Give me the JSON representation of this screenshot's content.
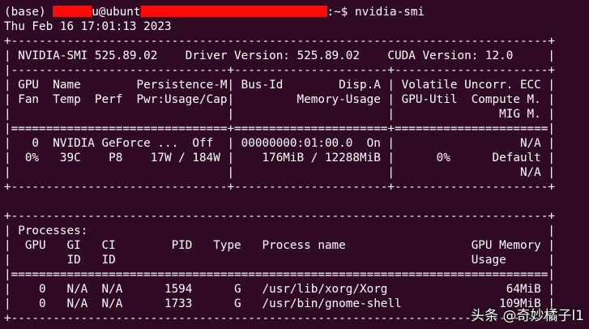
{
  "prompt": {
    "env": "(base) ",
    "user_suffix": "u@ubunt",
    "path_suffix": ":~$ ",
    "command": "nvidia-smi"
  },
  "output": [
    "Thu Feb 16 17:01:13 2023",
    "+-----------------------------------------------------------------------------+",
    "| NVIDIA-SMI 525.89.02    Driver Version: 525.89.02    CUDA Version: 12.0     |",
    "|-------------------------------+----------------------+----------------------+",
    "| GPU  Name        Persistence-M| Bus-Id        Disp.A | Volatile Uncorr. ECC |",
    "| Fan  Temp  Perf  Pwr:Usage/Cap|         Memory-Usage | GPU-Util  Compute M. |",
    "|                               |                      |               MIG M. |",
    "|===============================+======================+======================|",
    "|   0  NVIDIA GeForce ...  Off  | 00000000:01:00.0  On |                  N/A |",
    "|  0%   39C    P8    17W / 184W |    176MiB / 12288MiB |      0%      Default |",
    "|                               |                      |                  N/A |",
    "+-------------------------------+----------------------+----------------------+",
    "",
    "+-----------------------------------------------------------------------------+",
    "| Processes:                                                                  |",
    "|  GPU   GI   CI        PID   Type   Process name                  GPU Memory |",
    "|        ID   ID                                                   Usage      |",
    "|=============================================================================|",
    "|    0   N/A  N/A      1594      G   /usr/lib/xorg/Xorg                 64MiB |",
    "|    0   N/A  N/A      1733      G   /usr/bin/gnome-shell              109MiB |",
    "+-----------------------------------------------------------------------------+"
  ],
  "watermark": "头条 @奇妙橘子l1"
}
